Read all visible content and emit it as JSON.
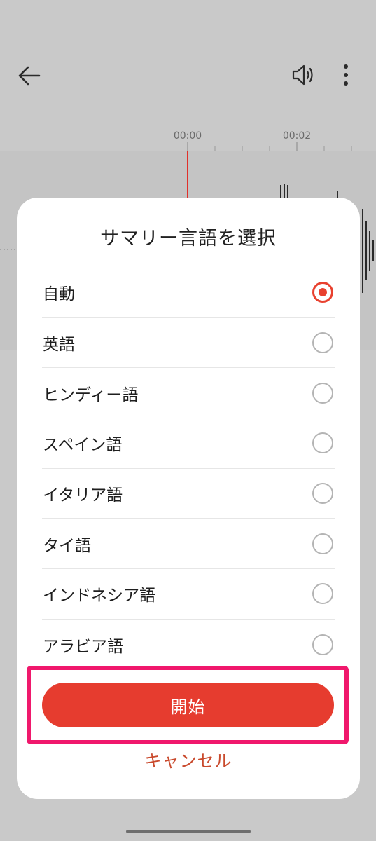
{
  "timeline": {
    "labels": [
      "00:00",
      "00:02"
    ]
  },
  "colors": {
    "accent": "#e63c2f",
    "cancel_text": "#c94a2d",
    "highlight": "#f0186c",
    "background": "#c9c9c9"
  },
  "dialog": {
    "title": "サマリー言語を選択",
    "options": [
      {
        "label": "自動",
        "selected": true
      },
      {
        "label": "英語",
        "selected": false
      },
      {
        "label": "ヒンディー語",
        "selected": false
      },
      {
        "label": "スペイン語",
        "selected": false
      },
      {
        "label": "イタリア語",
        "selected": false
      },
      {
        "label": "タイ語",
        "selected": false
      },
      {
        "label": "インドネシア語",
        "selected": false
      },
      {
        "label": "アラビア語",
        "selected": false
      }
    ],
    "start_label": "開始",
    "cancel_label": "キャンセル"
  }
}
